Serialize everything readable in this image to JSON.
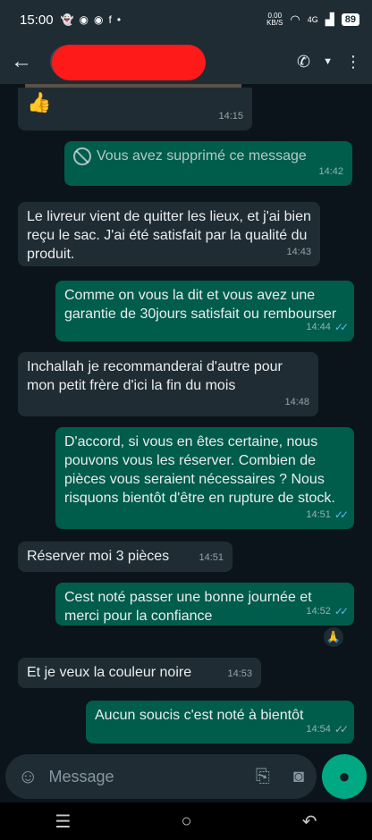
{
  "status_bar": {
    "time": "15:00",
    "left_icons": [
      "snapchat-icon",
      "messenger-icon",
      "messenger-icon",
      "facebook-icon",
      "dot-icon"
    ],
    "net_speed": "0.00",
    "net_unit": "KB/S",
    "network": "4G",
    "battery": "89"
  },
  "header": {
    "contact_name": "",
    "icons": [
      "call-icon",
      "dropdown-icon",
      "more-icon"
    ]
  },
  "messages": [
    {
      "dir": "in",
      "text": "👍",
      "time": "14:15"
    },
    {
      "dir": "out",
      "text": "Vous avez supprimé ce message",
      "time": "14:42",
      "deleted": true
    },
    {
      "dir": "in",
      "text": "Le livreur vient de quitter les lieux, et j'ai bien reçu le sac. J'ai été satisfait par la qualité du produit.",
      "time": "14:43"
    },
    {
      "dir": "out",
      "text": "Comme on vous la dit et vous avez une garantie de 30jours satisfait ou rembourser",
      "time": "14:44",
      "read": true
    },
    {
      "dir": "in",
      "text": "Inchallah je recommanderai d'autre pour mon petit frère d'ici la fin du mois",
      "time": "14:48"
    },
    {
      "dir": "out",
      "text": "D'accord, si vous en êtes certaine, nous pouvons vous les réserver. Combien de pièces vous seraient nécessaires ? Nous risquons bientôt d'être en rupture de stock.",
      "time": "14:51",
      "read": true
    },
    {
      "dir": "in",
      "text": "Réserver moi 3 pièces",
      "time": "14:51"
    },
    {
      "dir": "out",
      "text": "Cest noté passer une bonne journée et merci pour la confiance",
      "time": "14:52",
      "read": true,
      "reaction": "🙏"
    },
    {
      "dir": "in",
      "text": "Et je veux la couleur noire",
      "time": "14:53"
    },
    {
      "dir": "out",
      "text": "Aucun soucis c'est noté à bientôt",
      "time": "14:54",
      "read": false
    }
  ],
  "composer": {
    "placeholder": "Message",
    "icons": [
      "emoji-icon",
      "attach-icon",
      "camera-icon",
      "mic-icon"
    ]
  },
  "nav": {
    "icons": [
      "recents-icon",
      "home-icon",
      "back-icon"
    ]
  },
  "colors": {
    "incoming": "#1f2c33",
    "outgoing": "#005c4b",
    "accent": "#00a884",
    "read_ticks": "#53bdeb"
  }
}
